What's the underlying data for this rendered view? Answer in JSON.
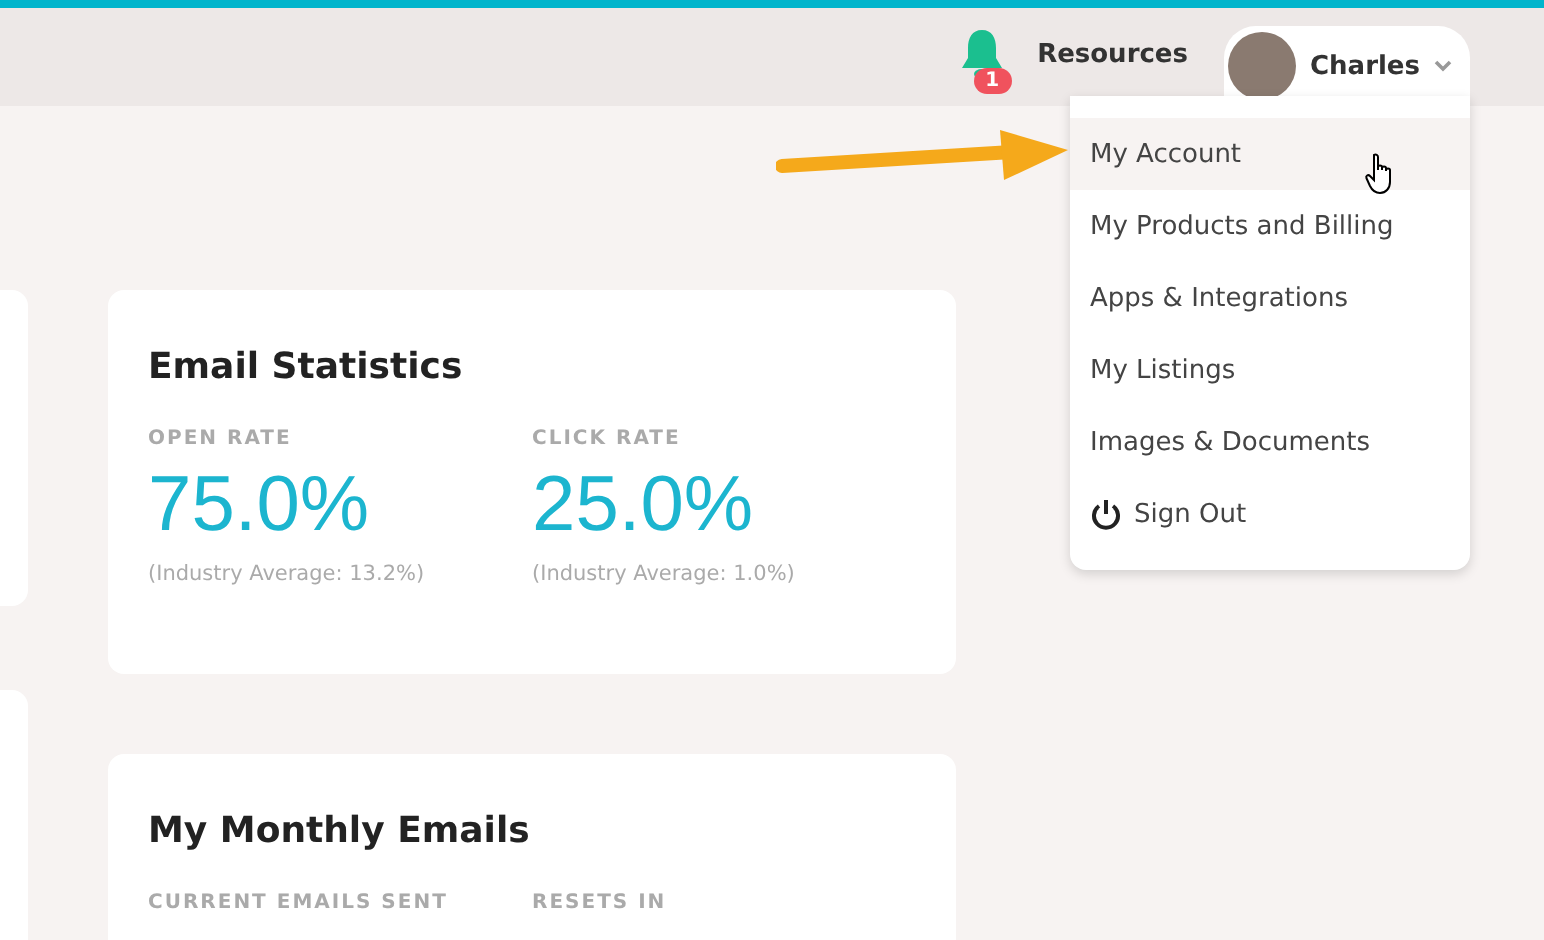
{
  "header": {
    "notification_count": "1",
    "resources_link": "Resources",
    "user": {
      "name": "Charles",
      "expanded": true
    }
  },
  "user_menu": [
    {
      "label": "My Account",
      "selected": true,
      "kind": "link"
    },
    {
      "label": "My Products and Billing",
      "selected": false,
      "kind": "link"
    },
    {
      "label": "Apps & Integrations",
      "selected": false,
      "kind": "link"
    },
    {
      "label": "My Listings",
      "selected": false,
      "kind": "link"
    },
    {
      "label": "Images & Documents",
      "selected": false,
      "kind": "link"
    },
    {
      "label": "Sign Out",
      "selected": false,
      "kind": "signout"
    }
  ],
  "cards": [
    {
      "title": "Email Statistics",
      "stats": [
        {
          "label": "OPEN RATE",
          "value": "75.0%",
          "note": "(Industry Average: 13.2%)"
        },
        {
          "label": "CLICK RATE",
          "value": "25.0%",
          "note": "(Industry Average: 1.0%)"
        }
      ]
    },
    {
      "title": "My Monthly Emails",
      "stats": [
        {
          "label": "CURRENT EMAILS SENT"
        },
        {
          "label": "RESETS IN"
        }
      ]
    }
  ]
}
